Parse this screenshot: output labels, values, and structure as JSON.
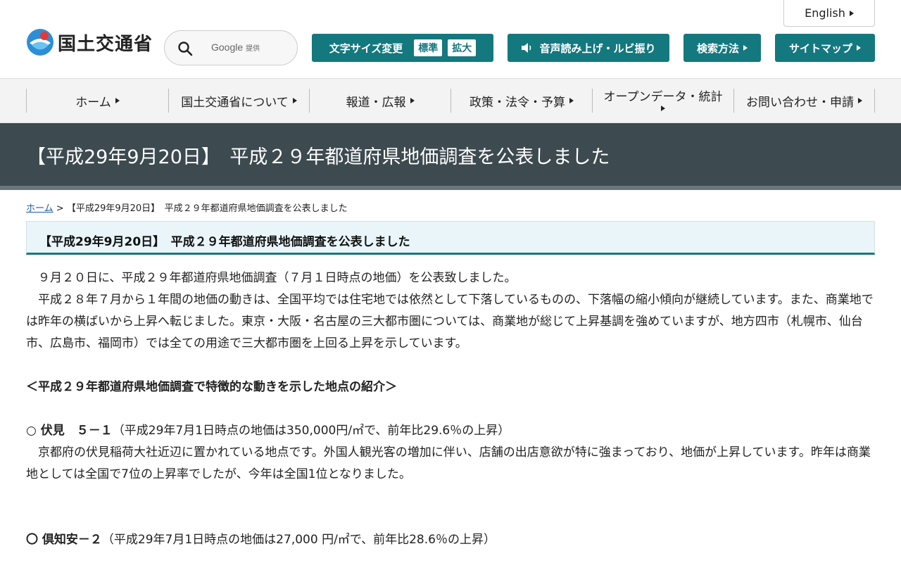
{
  "header": {
    "english": "English",
    "logo_text": "国土交通省",
    "search": {
      "brand": "Google",
      "sub": "提供"
    },
    "font_size": {
      "label": "文字サイズ変更",
      "standard": "標準",
      "large": "拡大"
    },
    "speech": "音声読み上げ・ルビ振り",
    "search_method": "検索方法",
    "sitemap": "サイトマップ"
  },
  "nav": {
    "items": [
      "ホーム",
      "国土交通省について",
      "報道・広報",
      "政策・法令・予算",
      "オープンデータ・統計",
      "お問い合わせ・申請"
    ]
  },
  "page": {
    "title": "【平成29年9月20日】　平成２９年都道府県地価調査を公表しました",
    "breadcrumb_home": "ホーム",
    "breadcrumb_sep": ">",
    "breadcrumb_current": "【平成29年9月20日】　平成２９年都道府県地価調査を公表しました",
    "section_title": "【平成29年9月20日】　平成２９年都道府県地価調査を公表しました"
  },
  "content": {
    "p1": "　９月２０日に、平成２９年都道府県地価調査（７月１日時点の地価）を公表致しました。",
    "p2": "　平成２８年７月から１年間の地価の動きは、全国平均では住宅地では依然として下落しているものの、下落幅の縮小傾向が継続しています。また、商業地では昨年の横ばいから上昇へ転じました。東京・大阪・名古屋の三大都市圏については、商業地が総じて上昇基調を強めていますが、地方四市（札幌市、仙台市、広島市、福岡市）では全ての用途で三大都市圏を上回る上昇を示しています。",
    "heading": "＜平成２９年都道府県地価調査で特徴的な動きを示した地点の紹介＞",
    "point1_name": "○ 伏見　５－１",
    "point1_detail": "（平成29年7月1日時点の地価は350,000円/㎡で、前年比29.6％の上昇）",
    "point1_desc": "　京都府の伏見稲荷大社近辺に置かれている地点です。外国人観光客の増加に伴い、店舗の出店意欲が特に強まっており、地価が上昇しています。昨年は商業地としては全国で7位の上昇率でしたが、今年は全国1位となりました。",
    "point2_name": "〇 倶知安－２",
    "point2_detail": "（平成29年7月1日時点の地価は27,000 円/㎡で、前年比28.6％の上昇）"
  },
  "colors": {
    "teal": "#14787f",
    "title_bar": "#3d4a4f",
    "section_bg": "#e9f5f8"
  }
}
